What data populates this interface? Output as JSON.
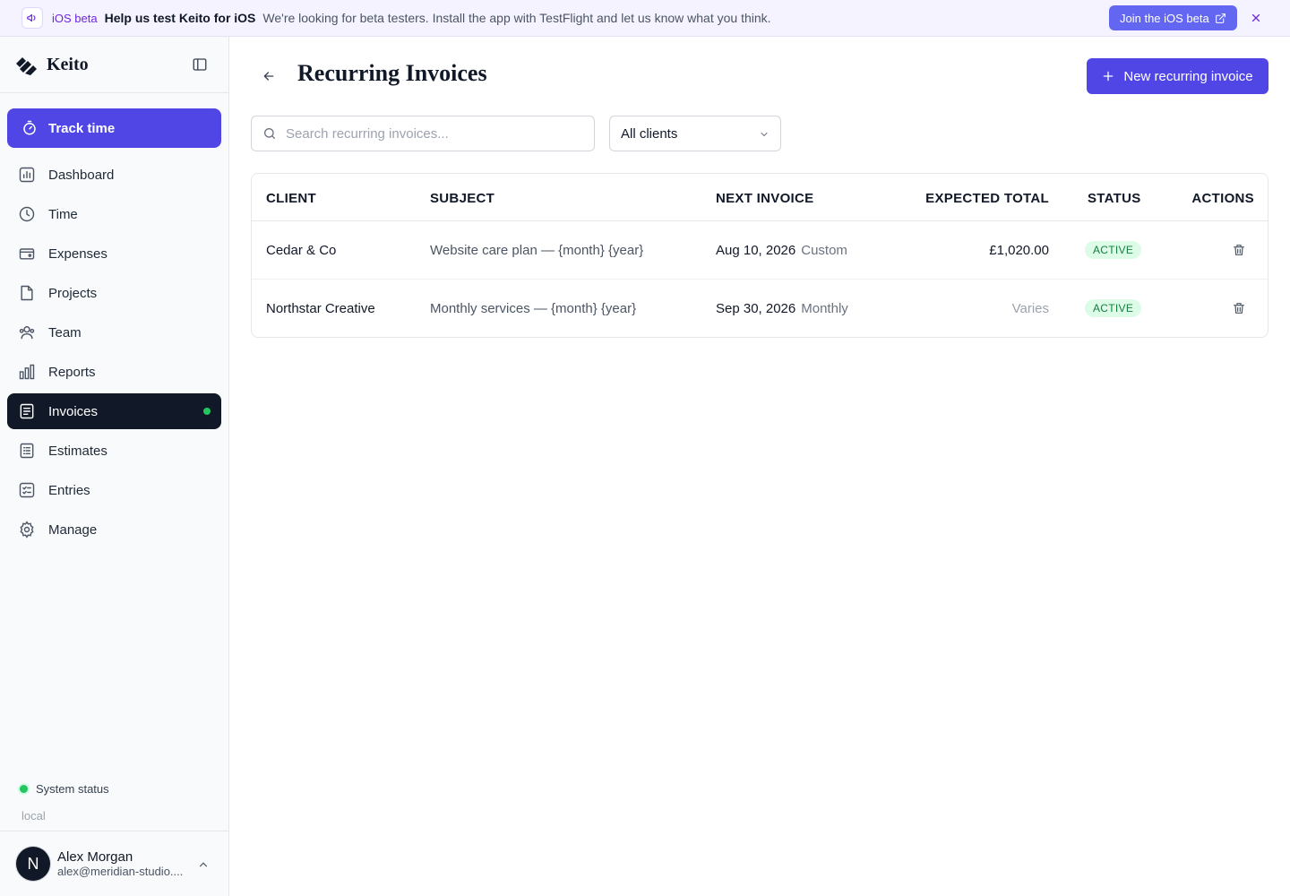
{
  "banner": {
    "icon": "megaphone-icon",
    "tag": "iOS beta",
    "headline": "Help us test Keito for iOS",
    "message": "We're looking for beta testers. Install the app with TestFlight and let us know what you think.",
    "join_label": "Join the iOS beta"
  },
  "app": {
    "name": "Keito"
  },
  "sidebar": {
    "track_label": "Track time",
    "items": [
      {
        "label": "Dashboard",
        "icon": "dashboard-icon"
      },
      {
        "label": "Time",
        "icon": "clock-icon"
      },
      {
        "label": "Expenses",
        "icon": "wallet-icon"
      },
      {
        "label": "Projects",
        "icon": "folder-icon"
      },
      {
        "label": "Team",
        "icon": "users-icon"
      },
      {
        "label": "Reports",
        "icon": "bar-chart-icon"
      },
      {
        "label": "Invoices",
        "icon": "invoice-icon",
        "active": true
      },
      {
        "label": "Estimates",
        "icon": "list-icon"
      },
      {
        "label": "Entries",
        "icon": "checklist-icon"
      },
      {
        "label": "Manage",
        "icon": "gear-icon"
      }
    ],
    "system_status": "System status",
    "environment": "local",
    "user": {
      "initial": "N",
      "name": "Alex Morgan",
      "email": "alex@meridian-studio...."
    }
  },
  "page": {
    "title": "Recurring Invoices",
    "new_button": "New recurring invoice",
    "search_placeholder": "Search recurring invoices...",
    "client_filter": "All clients"
  },
  "table": {
    "headers": {
      "client": "CLIENT",
      "subject": "SUBJECT",
      "next": "NEXT INVOICE",
      "total": "EXPECTED TOTAL",
      "status": "STATUS",
      "actions": "ACTIONS"
    },
    "rows": [
      {
        "client": "Cedar & Co",
        "subject": "Website care plan — {month} {year}",
        "next_date": "Aug 10, 2026",
        "frequency": "Custom",
        "total": "£1,020.00",
        "status": "ACTIVE"
      },
      {
        "client": "Northstar Creative",
        "subject": "Monthly services — {month} {year}",
        "next_date": "Sep 30, 2026",
        "frequency": "Monthly",
        "total": "Varies",
        "status": "ACTIVE"
      }
    ]
  },
  "colors": {
    "accent": "#4f46e5",
    "sidebar_active": "#111827",
    "status_ok": "#22c55e"
  }
}
